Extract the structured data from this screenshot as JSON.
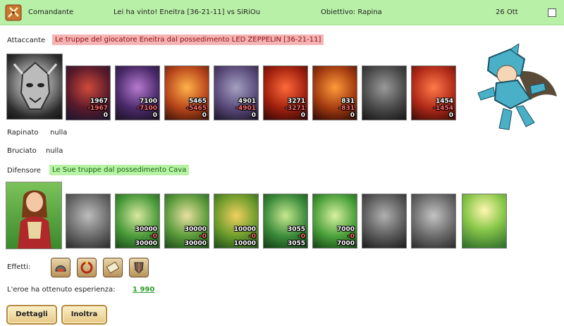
{
  "header": {
    "role": "Comandante",
    "result": "Lei ha vinto! Eneitra [36-21-11] vs SiRiOu",
    "objective": "Obiettivo: Rapina",
    "date": "26 Ott"
  },
  "attacker": {
    "label": "Attaccante",
    "description": "Le truppe del giocatore Eneitra dal possedimento LED ZEPPELIN [36-21-11]",
    "units": [
      {
        "start": "1967",
        "lost": "-1967",
        "left": "0"
      },
      {
        "start": "7100",
        "lost": "-7100",
        "left": "0"
      },
      {
        "start": "5465",
        "lost": "-5465",
        "left": "0"
      },
      {
        "start": "4901",
        "lost": "-4901",
        "left": "0"
      },
      {
        "start": "3271",
        "lost": "-3271",
        "left": "0"
      },
      {
        "start": "831",
        "lost": "-831",
        "left": "0"
      },
      {
        "start": "",
        "lost": "",
        "left": ""
      },
      {
        "start": "1454",
        "lost": "-1454",
        "left": "0"
      }
    ]
  },
  "plundered": {
    "label": "Rapinato",
    "value": "nulla"
  },
  "burned": {
    "label": "Bruciato",
    "value": "nulla"
  },
  "defender": {
    "label": "Difensore",
    "description": "Le Sue truppe dal possedimento Cava",
    "units": [
      {
        "start": "",
        "lost": "",
        "left": ""
      },
      {
        "start": "30000",
        "lost": "-0",
        "left": "30000"
      },
      {
        "start": "30000",
        "lost": "-0",
        "left": "30000"
      },
      {
        "start": "10000",
        "lost": "-0",
        "left": "10000"
      },
      {
        "start": "3055",
        "lost": "-0",
        "left": "3055"
      },
      {
        "start": "7000",
        "lost": "-0",
        "left": "7000"
      },
      {
        "start": "",
        "lost": "",
        "left": ""
      },
      {
        "start": "",
        "lost": "",
        "left": ""
      },
      {
        "start": "",
        "lost": "",
        "left": ""
      }
    ]
  },
  "effects": {
    "label": "Effetti:",
    "icons": [
      "helmet-icon",
      "ring-icon",
      "scroll-icon",
      "shield-icon"
    ]
  },
  "experience": {
    "label": "L'eroe ha ottenuto esperienza:",
    "value": "1 990"
  },
  "buttons": {
    "details": "Dettagli",
    "forward": "Inoltra"
  }
}
